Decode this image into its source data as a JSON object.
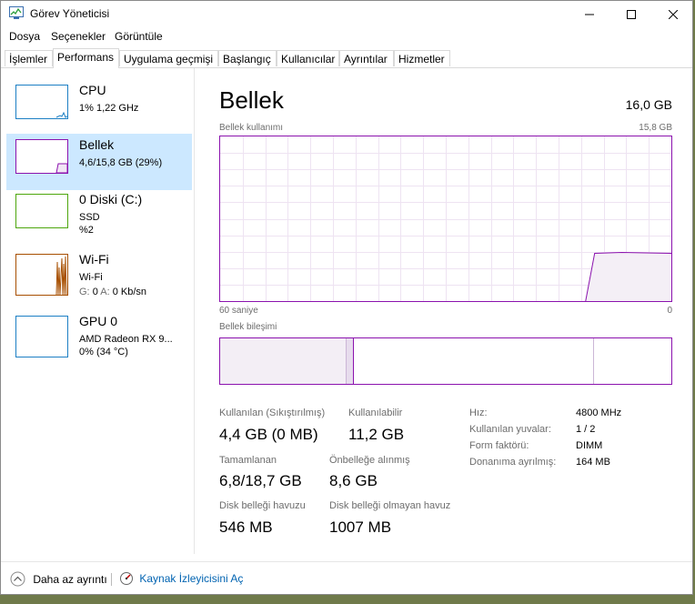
{
  "window": {
    "title": "Görev Yöneticisi"
  },
  "menu": [
    "Dosya",
    "Seçenekler",
    "Görüntüle"
  ],
  "tabs": [
    "İşlemler",
    "Performans",
    "Uygulama geçmişi",
    "Başlangıç",
    "Kullanıcılar",
    "Ayrıntılar",
    "Hizmetler"
  ],
  "active_tab": "Performans",
  "sidebar": [
    {
      "name": "CPU",
      "line1": "1%  1,22 GHz",
      "line2": "",
      "color": "#1c7fc4"
    },
    {
      "name": "Bellek",
      "line1": "4,6/15,8 GB (29%)",
      "line2": "",
      "color": "#8b12ae"
    },
    {
      "name": "0 Diski (C:)",
      "line1": "SSD",
      "line2": "%2",
      "color": "#4da60c"
    },
    {
      "name": "Wi-Fi",
      "line1": "Wi-Fi",
      "line2_prefix_g": "G:",
      "line2_g": "0",
      "line2_prefix_a": "A:",
      "line2_a": "0 Kb/sn",
      "color": "#a74f01"
    },
    {
      "name": "GPU 0",
      "line1": "AMD Radeon RX 9...",
      "line2": "0% (34 °C)",
      "color": "#1c7fc4"
    }
  ],
  "main": {
    "title": "Bellek",
    "total": "16,0 GB",
    "usage_label": "Bellek kullanımı",
    "usage_max": "15,8 GB",
    "time_left": "60 saniye",
    "time_right": "0",
    "composition_label": "Bellek bileşimi",
    "usage_fraction": 0.29,
    "accent_color": "#8b12ae"
  },
  "stats": {
    "in_use_label": "Kullanılan (Sıkıştırılmış)",
    "in_use_value": "4,4 GB (0 MB)",
    "available_label": "Kullanılabilir",
    "available_value": "11,2 GB",
    "committed_label": "Tamamlanan",
    "committed_value": "6,8/18,7 GB",
    "cached_label": "Önbelleğe alınmış",
    "cached_value": "8,6 GB",
    "paged_label": "Disk belleği havuzu",
    "paged_value": "546 MB",
    "nonpaged_label": "Disk belleği olmayan havuz",
    "nonpaged_value": "1007 MB"
  },
  "details": [
    {
      "key": "Hız:",
      "value": "4800 MHz"
    },
    {
      "key": "Kullanılan yuvalar:",
      "value": "1 / 2"
    },
    {
      "key": "Form faktörü:",
      "value": "DIMM"
    },
    {
      "key": "Donanıma ayrılmış:",
      "value": "164 MB"
    }
  ],
  "footer": {
    "fewer_details": "Daha az ayrıntı",
    "resource_monitor": "Kaynak İzleyicisini Aç"
  }
}
